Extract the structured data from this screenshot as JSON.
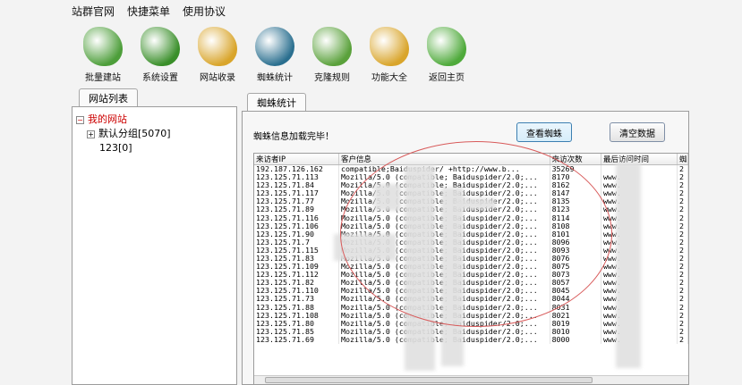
{
  "menu": [
    "站群官网",
    "快捷菜单",
    "使用协议"
  ],
  "toolbar": [
    {
      "label": "批量建站",
      "icon": "globe-leaf-icon",
      "color": "#4d9e3a"
    },
    {
      "label": "系统设置",
      "icon": "gear-leaf-icon",
      "color": "#3a8f2a"
    },
    {
      "label": "网站收录",
      "icon": "folder-leaf-icon",
      "color": "#d9a52b"
    },
    {
      "label": "蜘蛛统计",
      "icon": "spider-icon",
      "color": "#2a6f8f"
    },
    {
      "label": "克隆规则",
      "icon": "leaf-rule-icon",
      "color": "#5aa13b"
    },
    {
      "label": "功能大全",
      "icon": "folder-globe-icon",
      "color": "#d9a52b"
    },
    {
      "label": "返回主页",
      "icon": "home-icon",
      "color": "#4faa3b"
    }
  ],
  "left_tab": "网站列表",
  "tree": {
    "root": "我的网站",
    "children": [
      "默认分组[5070]",
      "123[0]"
    ]
  },
  "right_tab": "蜘蛛统计",
  "message": "蜘蛛信息加载完毕！",
  "buttons": {
    "view": "查看蜘蛛",
    "clear": "清空数据"
  },
  "columns": [
    "来访者IP",
    "客户信息",
    "来访次数",
    "最后访问时间",
    "蜘"
  ],
  "rows": [
    [
      "192.187.126.162",
      "compatible;Baiduspider/ +http://www.b...",
      "35269",
      "",
      "2"
    ],
    [
      "123.125.71.113",
      "Mozilla/5.0 (compatible; Baiduspider/2.0;...",
      "8170",
      "www.",
      "2"
    ],
    [
      "123.125.71.84",
      "Mozilla/5.0 (compatible; Baiduspider/2.0;...",
      "8162",
      "www.",
      "2"
    ],
    [
      "123.125.71.117",
      "Mozilla/5.0 (compatible; Baiduspider/2.0;...",
      "8147",
      "www.",
      "2"
    ],
    [
      "123.125.71.77",
      "Mozilla/5.0 (compatible; Baiduspider/2.0;...",
      "8135",
      "www.",
      "2"
    ],
    [
      "123.125.71.89",
      "Mozilla/5.0 (compatible; Baiduspider/2.0;...",
      "8123",
      "www.",
      "2"
    ],
    [
      "123.125.71.116",
      "Mozilla/5.0 (compatible; Baiduspider/2.0;...",
      "8114",
      "www.",
      "2"
    ],
    [
      "123.125.71.106",
      "Mozilla/5.0 (compatible; Baiduspider/2.0;...",
      "8108",
      "www.",
      "2"
    ],
    [
      "123.125.71.90",
      "Mozilla/5.0 (compatible; Baiduspider/2.0;...",
      "8101",
      "www.",
      "2"
    ],
    [
      "123.125.71.7",
      "Mozilla/5.0 (compatible; Baiduspider/2.0;...",
      "8096",
      "www.",
      "2"
    ],
    [
      "123.125.71.115",
      "Mozilla/5.0 (compatible; Baiduspider/2.0;...",
      "8093",
      "www.",
      "2"
    ],
    [
      "123.125.71.83",
      "Mozilla/5.0 (compatible; Baiduspider/2.0;...",
      "8076",
      "www.",
      "2"
    ],
    [
      "123.125.71.109",
      "Mozilla/5.0 (compatible; Baiduspider/2.0;...",
      "8075",
      "www.",
      "2"
    ],
    [
      "123.125.71.112",
      "Mozilla/5.0 (compatible; Baiduspider/2.0;...",
      "8073",
      "www.",
      "2"
    ],
    [
      "123.125.71.82",
      "Mozilla/5.0 (compatible; Baiduspider/2.0;...",
      "8057",
      "www.",
      "2"
    ],
    [
      "123.125.71.110",
      "Mozilla/5.0 (compatible; Baiduspider/2.0;...",
      "8045",
      "www.",
      "2"
    ],
    [
      "123.125.71.73",
      "Mozilla/5.0 (compatible; Baiduspider/2.0;...",
      "8044",
      "www.",
      "2"
    ],
    [
      "123.125.71.88",
      "Mozilla/5.0 (compatible; Baiduspider/2.0;...",
      "8031",
      "www.",
      "2"
    ],
    [
      "123.125.71.108",
      "Mozilla/5.0 (compatible; Baiduspider/2.0;...",
      "8021",
      "www.",
      "2"
    ],
    [
      "123.125.71.80",
      "Mozilla/5.0 (compatible; Baiduspider/2.0;...",
      "8019",
      "www.",
      "2"
    ],
    [
      "123.125.71.85",
      "Mozilla/5.0 (compatible; Baiduspider/2.0;...",
      "8010",
      "www.",
      "2"
    ],
    [
      "123.125.71.69",
      "Mozilla/5.0 (compatible; Baiduspider/2.0;...",
      "8000",
      "www.",
      "2"
    ]
  ]
}
